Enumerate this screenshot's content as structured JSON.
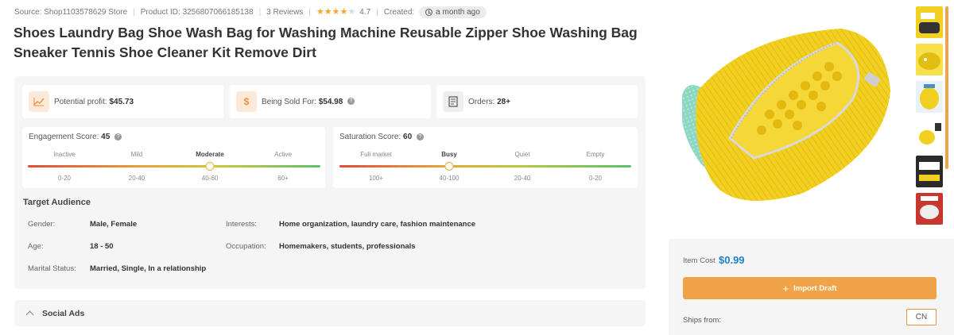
{
  "meta": {
    "source": "Source: Shop1103578629 Store",
    "product_id": "Product ID: 3256807066185138",
    "reviews": "3 Reviews",
    "rating": "4.7",
    "created_label": "Created:",
    "created_value": "a month ago"
  },
  "title": "Shoes Laundry Bag Shoe Wash Bag for Washing Machine Reusable Zipper Shoe Washing Bag Sneaker Tennis Shoe Cleaner Kit Remove Dirt",
  "stats": {
    "profit_label": "Potential profit:",
    "profit_value": "$45.73",
    "sold_label": "Being Sold For:",
    "sold_value": "$54.98",
    "orders_label": "Orders:",
    "orders_value": "28+"
  },
  "engagement": {
    "label": "Engagement Score:",
    "value": "45",
    "levels": [
      "Inactive",
      "Mild",
      "Moderate",
      "Active"
    ],
    "ranges": [
      "0-20",
      "20-40",
      "40-60",
      "60+"
    ]
  },
  "saturation": {
    "label": "Saturation Score:",
    "value": "60",
    "levels": [
      "Full market",
      "Busy",
      "Quiet",
      "Empty"
    ],
    "ranges": [
      "100+",
      "40-100",
      "20-40",
      "0-20"
    ]
  },
  "audience": {
    "title": "Target Audience",
    "gender_label": "Gender:",
    "gender_value": "Male, Female",
    "age_label": "Age:",
    "age_value": "18 - 50",
    "marital_label": "Marital Status:",
    "marital_value": "Married, Single, In a relationship",
    "interests_label": "Interests:",
    "interests_value": "Home organization, laundry care, fashion maintenance",
    "occupation_label": "Occupation:",
    "occupation_value": "Homemakers, students, professionals"
  },
  "social": {
    "label": "Social Ads"
  },
  "buy": {
    "cost_label": "Item Cost",
    "cost_value": "$0.99",
    "import_label": "Import Draft",
    "ships_label": "Ships from:",
    "ships_value": "CN"
  },
  "colors": {
    "accent": "#f0a347",
    "price": "#1e7fc8",
    "product": "#f2d021"
  }
}
